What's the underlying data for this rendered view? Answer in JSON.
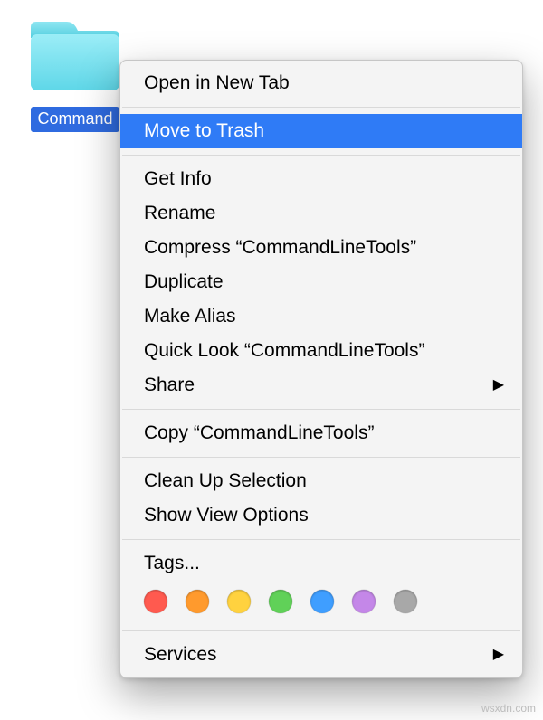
{
  "folder": {
    "name": "CommandLineTools",
    "label_visible": "Command",
    "icon_tint": "#6fd9e8"
  },
  "menu": {
    "highlight_color": "#2f7bf6",
    "items": [
      {
        "label": "Open in New Tab",
        "type": "item"
      },
      {
        "type": "separator"
      },
      {
        "label": "Move to Trash",
        "type": "item",
        "highlighted": true
      },
      {
        "type": "separator"
      },
      {
        "label": "Get Info",
        "type": "item"
      },
      {
        "label": "Rename",
        "type": "item"
      },
      {
        "label": "Compress “CommandLineTools”",
        "type": "item"
      },
      {
        "label": "Duplicate",
        "type": "item"
      },
      {
        "label": "Make Alias",
        "type": "item"
      },
      {
        "label": "Quick Look “CommandLineTools”",
        "type": "item"
      },
      {
        "label": "Share",
        "type": "submenu"
      },
      {
        "type": "separator"
      },
      {
        "label": "Copy “CommandLineTools”",
        "type": "item"
      },
      {
        "type": "separator"
      },
      {
        "label": "Clean Up Selection",
        "type": "item"
      },
      {
        "label": "Show View Options",
        "type": "item"
      },
      {
        "type": "separator"
      },
      {
        "label": "Tags...",
        "type": "item"
      },
      {
        "type": "tags"
      },
      {
        "type": "separator"
      },
      {
        "label": "Services",
        "type": "submenu"
      }
    ]
  },
  "tags": [
    {
      "name": "red",
      "color": "#ff5a4f"
    },
    {
      "name": "orange",
      "color": "#ff9a2d"
    },
    {
      "name": "yellow",
      "color": "#ffd23f"
    },
    {
      "name": "green",
      "color": "#60d158"
    },
    {
      "name": "blue",
      "color": "#3f9eff"
    },
    {
      "name": "purple",
      "color": "#c487e8"
    },
    {
      "name": "gray",
      "color": "#a8a8a8"
    }
  ],
  "watermark": "wsxdn.com"
}
